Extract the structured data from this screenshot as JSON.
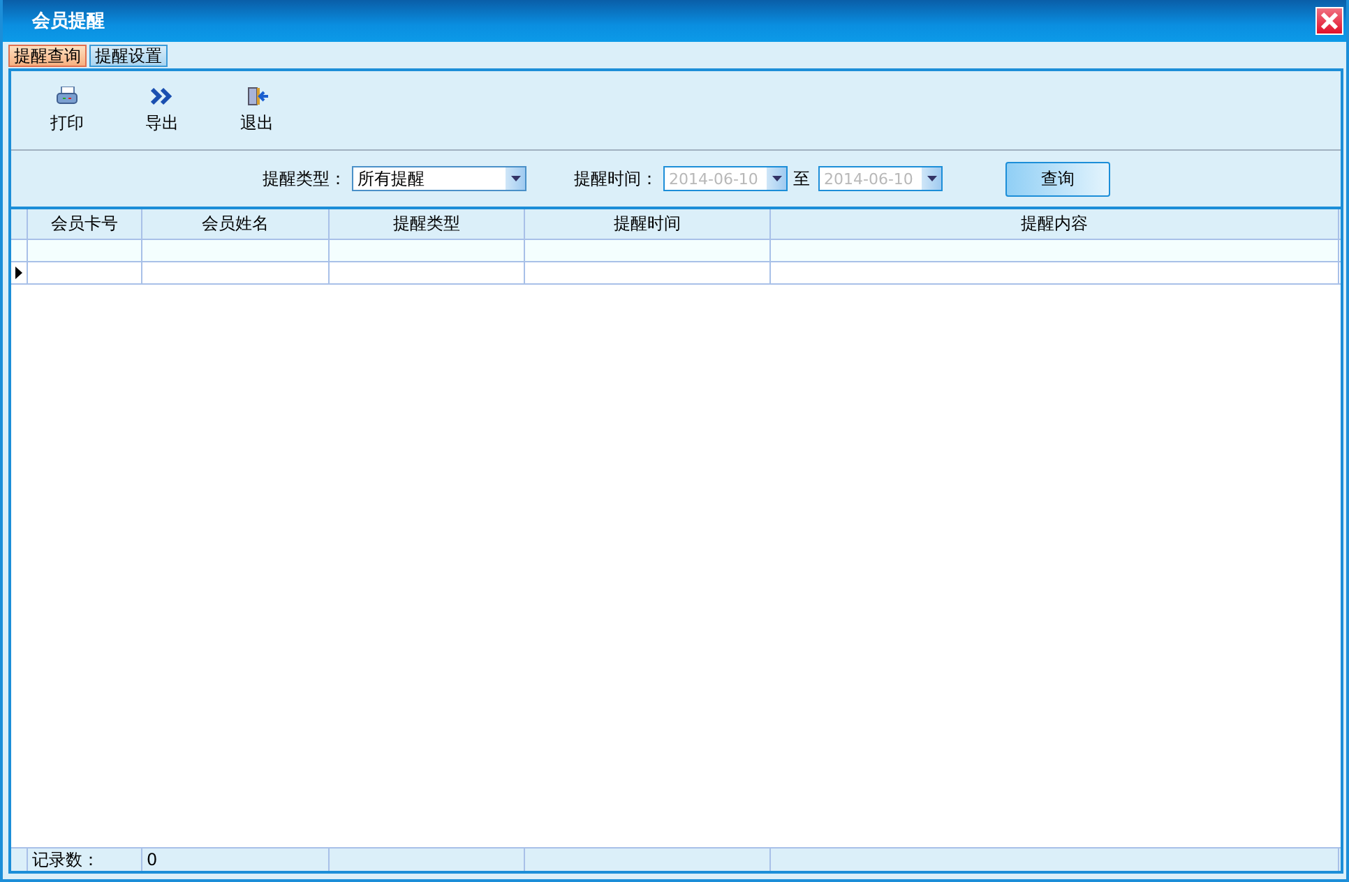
{
  "window": {
    "title": "会员提醒"
  },
  "tabs": [
    {
      "label": "提醒查询",
      "selected": true
    },
    {
      "label": "提醒设置",
      "selected": false
    }
  ],
  "toolbar": [
    {
      "kind": "print",
      "label": "打印"
    },
    {
      "kind": "export",
      "label": "导出"
    },
    {
      "kind": "exit",
      "label": "退出"
    }
  ],
  "filter": {
    "type_label": "提醒类型：",
    "type_value": "所有提醒",
    "time_label": "提醒时间：",
    "date_from": {
      "value": "2014-06-10",
      "disabled": true
    },
    "separator": "至",
    "date_to": {
      "value": "2014-06-10",
      "disabled": true
    },
    "query_button": "查询"
  },
  "table": {
    "columns": [
      "会员卡号",
      "会员姓名",
      "提醒类型",
      "提醒时间",
      "提醒内容"
    ],
    "rows": [
      {
        "selected": false
      },
      {
        "selected": true
      }
    ]
  },
  "footer": {
    "label": "记录数：",
    "count": "0"
  }
}
